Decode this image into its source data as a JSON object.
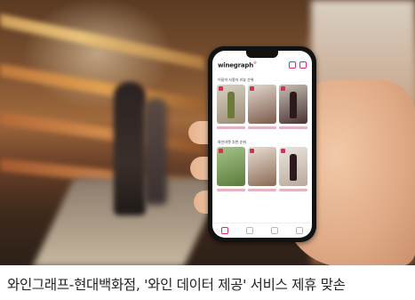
{
  "app": {
    "logo_text": "winegraph",
    "section_1_title": "이달의 사용자 리뷰 순위",
    "section_2_title": "와인마켓 추천 순위"
  },
  "caption": {
    "text": "와인그래프-현대백화점, '와인 데이터 제공' 서비스 제휴 맞손"
  },
  "colors": {
    "brand": "#d1305a",
    "caption_text": "#222222"
  },
  "icons": [
    "search-icon",
    "menu-icon",
    "home-icon",
    "explore-icon",
    "bookmark-icon",
    "profile-icon"
  ]
}
